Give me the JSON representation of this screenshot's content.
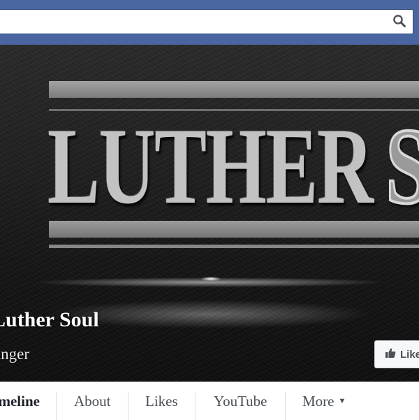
{
  "header": {
    "search": {
      "value": "",
      "placeholder": ""
    }
  },
  "cover": {
    "logo": {
      "word1": "LUTHER",
      "word2": "SOUL"
    }
  },
  "profile": {
    "name": "Luther Soul",
    "category": "Singer",
    "like_label": "Like"
  },
  "tabs": [
    {
      "label": "Timeline"
    },
    {
      "label": "About"
    },
    {
      "label": "Likes"
    },
    {
      "label": "YouTube"
    },
    {
      "label": "More"
    }
  ],
  "colors": {
    "topbar": "#4a66a0",
    "tab_text": "#4b4f56"
  },
  "icons": {
    "search": "search-icon",
    "like": "thumbs-up-icon",
    "more": "caret-down-icon"
  }
}
